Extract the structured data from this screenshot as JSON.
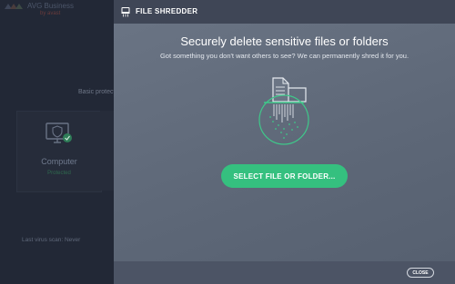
{
  "app": {
    "brand_name": "AVG Business",
    "brand_sub": "by avast"
  },
  "background": {
    "basic_protection_label": "Basic protect",
    "computer_card": {
      "title": "Computer",
      "status": "Protected"
    },
    "last_scan": "Last virus scan: Never"
  },
  "dialog": {
    "title": "FILE SHREDDER",
    "heading": "Securely delete sensitive files or folders",
    "subtext": "Got something you don't want others to see? We can permanently shred it for you.",
    "select_button": "SELECT FILE OR FOLDER...",
    "close_button": "CLOSE"
  },
  "colors": {
    "accent_green": "#35c07f",
    "dialog_bg": "#5e6878",
    "titlebar_bg": "#3f4656",
    "sidebar_bg": "#222836"
  },
  "icons": {
    "title_icon": "shredder-icon",
    "computer_icon": "monitor-shield-icon",
    "illustration": "file-shredder-illustration"
  }
}
